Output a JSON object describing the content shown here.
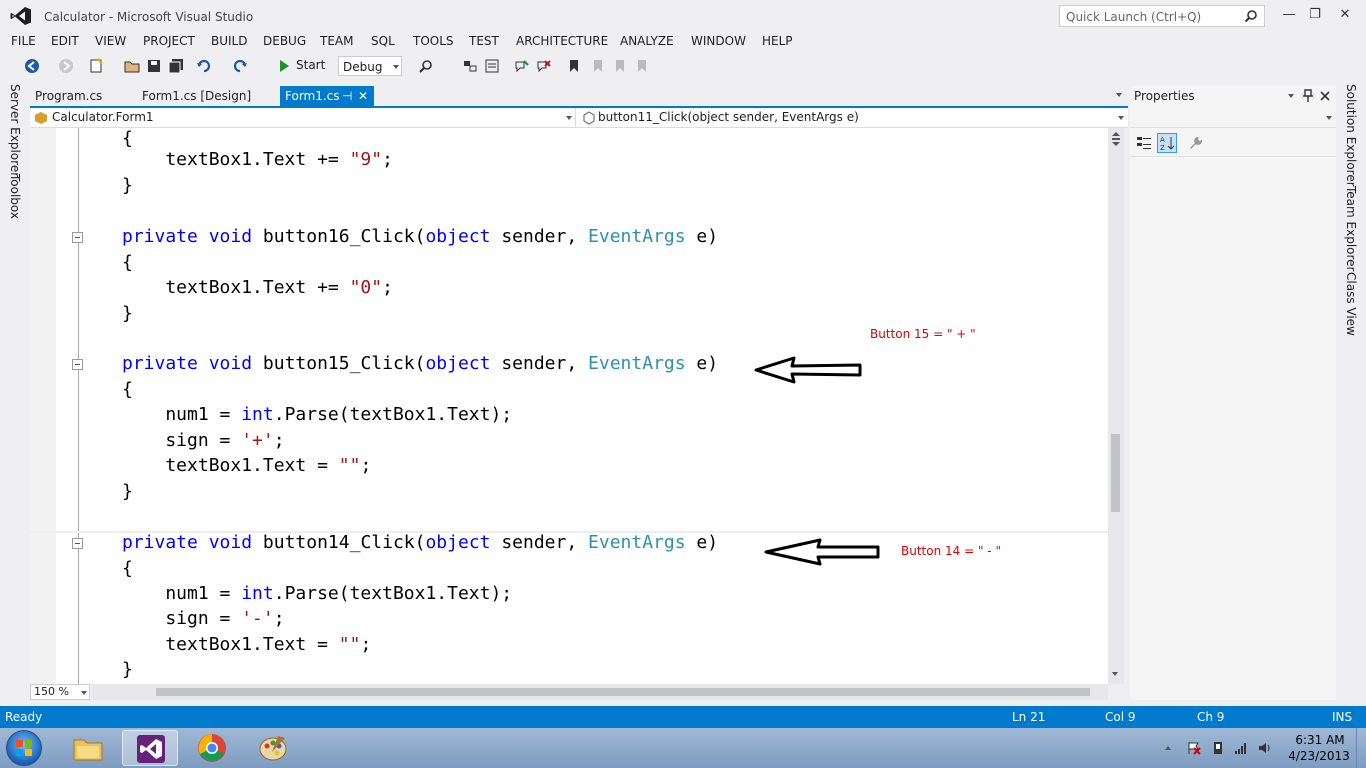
{
  "window": {
    "title": "Calculator - Microsoft Visual Studio",
    "quick_launch_placeholder": "Quick Launch (Ctrl+Q)",
    "minimize": "—",
    "restore": "❐",
    "close": "✕"
  },
  "menu": [
    "FILE",
    "EDIT",
    "VIEW",
    "PROJECT",
    "BUILD",
    "DEBUG",
    "TEAM",
    "SQL",
    "TOOLS",
    "TEST",
    "ARCHITECTURE",
    "ANALYZE",
    "WINDOW",
    "HELP"
  ],
  "toolbar": {
    "start_label": "Start",
    "configuration": "Debug"
  },
  "left_rail": [
    "Server Explorer",
    "Toolbox"
  ],
  "right_rail": [
    "Solution Explorer",
    "Team Explorer",
    "Class View"
  ],
  "tabs": [
    {
      "label": "Program.cs"
    },
    {
      "label": "Form1.cs [Design]"
    },
    {
      "label": "Form1.cs",
      "pin": "⊣",
      "close": "✕"
    }
  ],
  "navbar": {
    "class_scope": "Calculator.Form1",
    "member_scope": "button11_Click(object sender, EventArgs e)"
  },
  "code": {
    "l1": "{",
    "l2_a": "    textBox1.Text += ",
    "l2_s": "\"9\"",
    "l2_b": ";",
    "l3": "}",
    "m1_kw1": "private",
    "m1_kw2": "void",
    "m1_name": "button16_Click(",
    "m1_kw3": "object",
    "m1_mid": " sender, ",
    "m1_type": "EventArgs",
    "m1_end": " e)",
    "m1_open": "{",
    "m1_body_a": "    textBox1.Text += ",
    "m1_body_s": "\"0\"",
    "m1_body_b": ";",
    "m1_close": "}",
    "m2_kw1": "private",
    "m2_kw2": "void",
    "m2_name": "button15_Click(",
    "m2_kw3": "object",
    "m2_mid": " sender, ",
    "m2_type": "EventArgs",
    "m2_end": " e)",
    "m2_open": "{",
    "m2_b1_a": "    num1 = ",
    "m2_b1_kw": "int",
    "m2_b1_b": ".Parse(textBox1.Text);",
    "m2_b2_a": "    sign = ",
    "m2_b2_s": "'+'",
    "m2_b2_b": ";",
    "m2_b3_a": "    textBox1.Text = ",
    "m2_b3_s": "\"\"",
    "m2_b3_b": ";",
    "m2_close": "}",
    "m3_kw1": "private",
    "m3_kw2": "void",
    "m3_name": "button14_Click(",
    "m3_kw3": "object",
    "m3_mid": " sender, ",
    "m3_type": "EventArgs",
    "m3_end": " e)",
    "m3_open": "{",
    "m3_b1_a": "    num1 = ",
    "m3_b1_kw": "int",
    "m3_b1_b": ".Parse(textBox1.Text);",
    "m3_b2_a": "    sign = ",
    "m3_b2_s": "'-'",
    "m3_b2_b": ";",
    "m3_b3_a": "    textBox1.Text = ",
    "m3_b3_s": "\"\"",
    "m3_b3_b": ";",
    "m3_close": "}"
  },
  "annotations": {
    "button15": "Button 15 = \" + \"",
    "button14": "Button 14 = \" - \""
  },
  "editor": {
    "zoom": "150 %"
  },
  "properties": {
    "title": "Properties"
  },
  "status": {
    "state": "Ready",
    "line": "Ln 21",
    "col": "Col 9",
    "ch": "Ch 9",
    "mode": "INS"
  },
  "tray": {
    "time": "6:31 AM",
    "date": "4/23/2013"
  },
  "colors": {
    "accent": "#007acc",
    "keyword": "#0000ff",
    "type": "#2b91af",
    "string": "#a31515",
    "annotation": "#e00000"
  }
}
